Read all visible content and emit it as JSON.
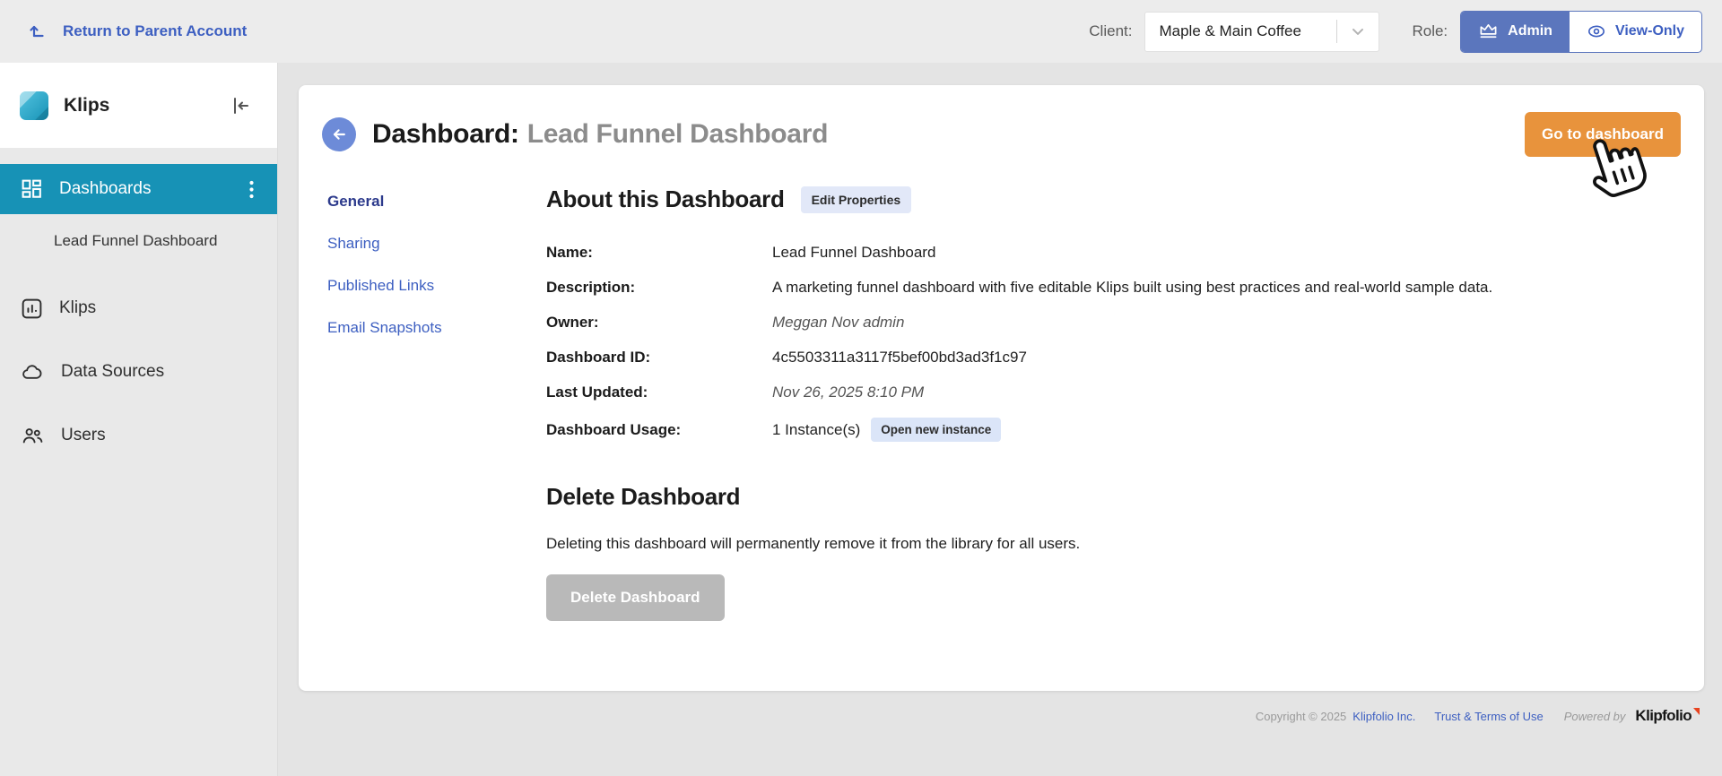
{
  "colors": {
    "topbar_bg": "#ececec",
    "accent_teal": "#1792b6",
    "role_blue": "#5b76bd",
    "link_blue": "#3d5fc1",
    "back_blue": "#6d8bd8",
    "primary_orange": "#e8933c",
    "chip_bg": "#e2e8f8",
    "disabled_gray": "#b9b9b9"
  },
  "icons": {
    "return": "arrow-up-from-line",
    "client_chevron": "chevron-down",
    "admin": "crown",
    "view_only": "eye",
    "brand": "klips-logo",
    "collapse": "collapse-left",
    "dashboards": "dashboard-grid",
    "menu": "kebab-vertical-dots",
    "klips": "bar-chart-box",
    "data_sources": "cloud",
    "users": "people",
    "back": "arrow-left",
    "cursor": "hand-pointer"
  },
  "topbar": {
    "return_link": "Return to Parent Account",
    "client_label": "Client:",
    "client_value": "Maple & Main Coffee",
    "role_label": "Role:",
    "role_admin": "Admin",
    "role_viewonly": "View-Only"
  },
  "sidebar": {
    "brand": "Klips",
    "items": [
      {
        "label": "Dashboards"
      },
      {
        "label": "Lead Funnel Dashboard"
      },
      {
        "label": "Klips"
      },
      {
        "label": "Data Sources"
      },
      {
        "label": "Users"
      }
    ]
  },
  "main": {
    "title_prefix": "Dashboard:",
    "title_name": "Lead Funnel Dashboard",
    "go_button": "Go to dashboard",
    "nav": [
      {
        "label": "General"
      },
      {
        "label": "Sharing"
      },
      {
        "label": "Published Links"
      },
      {
        "label": "Email Snapshots"
      }
    ],
    "about": {
      "heading": "About this Dashboard",
      "edit_button": "Edit Properties",
      "fields": [
        {
          "label": "Name:",
          "value": "Lead Funnel Dashboard"
        },
        {
          "label": "Description:",
          "value": "A marketing funnel dashboard with five editable Klips built using best practices and real-world sample data."
        },
        {
          "label": "Owner:",
          "value": "Meggan Nov admin"
        },
        {
          "label": "Dashboard ID:",
          "value": "4c5503311a3117f5bef00bd3ad3f1c97"
        },
        {
          "label": "Last Updated:",
          "value": "Nov 26, 2025 8:10 PM"
        }
      ],
      "usage": {
        "label": "Dashboard Usage:",
        "value": "1 Instance(s)",
        "button": "Open new instance"
      }
    },
    "delete": {
      "heading": "Delete Dashboard",
      "warning": "Deleting this dashboard will permanently remove it from the library for all users.",
      "button": "Delete Dashboard"
    }
  },
  "footer": {
    "copyright_prefix": "Copyright © 2025",
    "company_link": "Klipfolio Inc.",
    "terms_link": "Trust & Terms of Use",
    "powered_by": "Powered by",
    "logo_text": "Klipfolio"
  }
}
